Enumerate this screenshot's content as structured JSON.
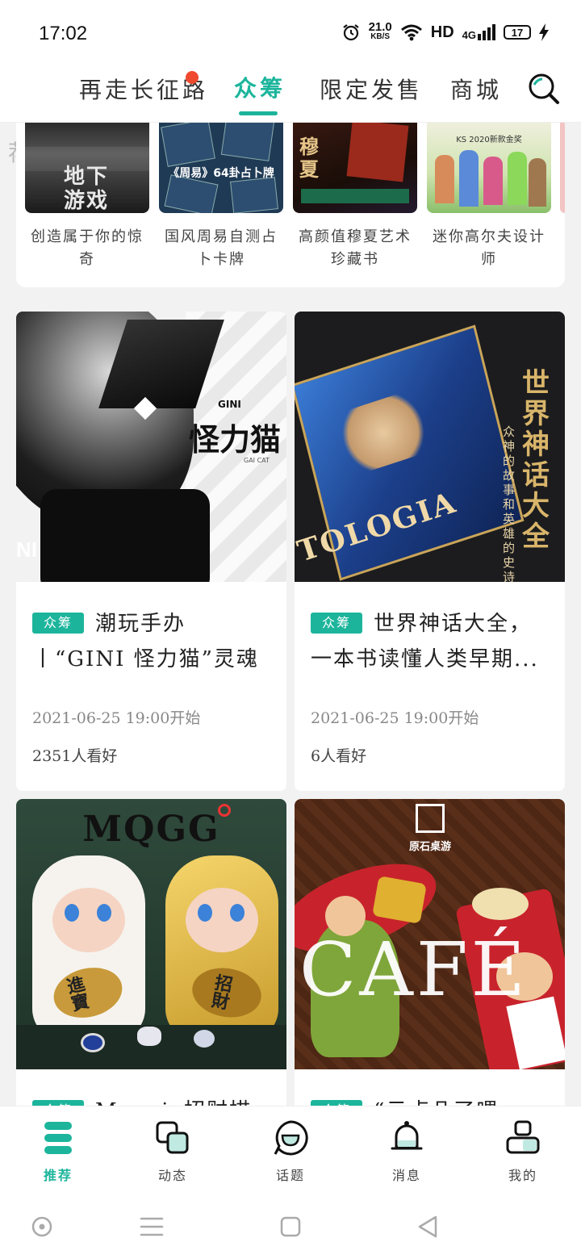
{
  "status_bar": {
    "time": "17:02",
    "net_speed": "21.0",
    "net_unit": "KB/S",
    "hd": "HD",
    "signal": "4G",
    "battery": "17"
  },
  "tabs": [
    {
      "label": "荐"
    },
    {
      "label": "再走长征路"
    },
    {
      "label": "众筹"
    },
    {
      "label": "限定发售"
    },
    {
      "label": "商城"
    }
  ],
  "colors": {
    "accent": "#1cb59c",
    "dot": "#f04a2e"
  },
  "horizontal": {
    "items": [
      {
        "caption": "创造属于你的惊奇",
        "thumb_text": "地下游戏"
      },
      {
        "caption": "国风周易自测占卜卡牌",
        "thumb_text": "《周易》64卦占卜牌"
      },
      {
        "caption": "高颜值穆夏艺术珍藏书",
        "thumb_text": "穆夏"
      },
      {
        "caption": "迷你高尔夫设计师",
        "thumb_text": "KS 2020新款金奖"
      }
    ]
  },
  "cards": [
    {
      "badge": "众筹",
      "title": "潮玩手办丨“GINI 怪力猫”灵魂深处的...",
      "date": "2021-06-25 19:00开始",
      "likes": "2351人看好",
      "img_title": "怪力猫",
      "img_brand": "GINI",
      "img_sub": "GAI CAT"
    },
    {
      "badge": "众筹",
      "title": "世界神话大全，一本书读懂人类早期...",
      "date": "2021-06-25 19:00开始",
      "likes": "6人看好",
      "img_title": "世界神话大全",
      "img_sub": "众神的故事和英雄的史诗",
      "img_spine": "TOLOGIA"
    },
    {
      "badge": "众筹",
      "title": "Magaia招财描摩",
      "img_title": "MQGG",
      "img_t1": "進寶",
      "img_t2": "招財"
    },
    {
      "badge": "众筹",
      "title": "“云点几了喂",
      "img_title": "CAFÉ",
      "img_brand": "原石桌游"
    }
  ],
  "bottom_nav": [
    {
      "label": "推荐",
      "icon": "home-stack-icon"
    },
    {
      "label": "动态",
      "icon": "squares-icon"
    },
    {
      "label": "话题",
      "icon": "chat-bubble-icon"
    },
    {
      "label": "消息",
      "icon": "bell-icon"
    },
    {
      "label": "我的",
      "icon": "profile-icon"
    }
  ]
}
